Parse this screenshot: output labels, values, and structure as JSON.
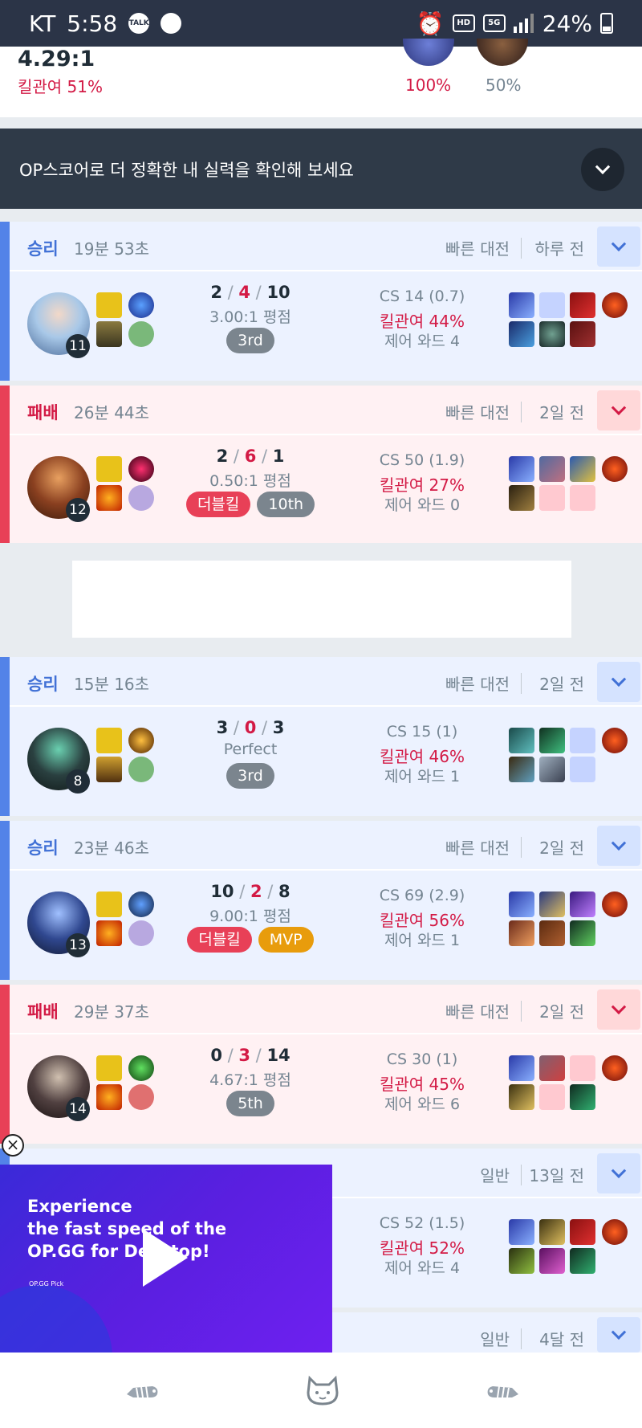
{
  "status": {
    "carrier": "KT",
    "time": "5:58",
    "battery": "24%",
    "icons": [
      "talk-icon",
      "cloud-icon",
      "alarm-icon",
      "hd-icon",
      "5g-icon",
      "signal-icon",
      "battery-icon"
    ]
  },
  "summary": {
    "kda_ratio": "4.29:1",
    "kill_participation": "킬관여 51%",
    "champions": [
      {
        "pct": "100%",
        "color": "#d31a45"
      },
      {
        "pct": "50%",
        "color": "#758592"
      }
    ]
  },
  "banner": {
    "text": "OP스코어로 더 정확한 내 실력을 확인해 보세요"
  },
  "matches": [
    {
      "result": "승리",
      "duration": "19분 53초",
      "queue": "빠른 대전",
      "ago": "하루 전",
      "level": "11",
      "k": "2",
      "d": "4",
      "a": "10",
      "ratio": "3.00:1 평점",
      "badges": [
        "3rd"
      ],
      "cs": "CS 14 (0.7)",
      "kp": "킬관여 44%",
      "ward": "제어 와드 4"
    },
    {
      "result": "패배",
      "duration": "26분 44초",
      "queue": "빠른 대전",
      "ago": "2일 전",
      "level": "12",
      "k": "2",
      "d": "6",
      "a": "1",
      "ratio": "0.50:1 평점",
      "badges": [
        "더블킬",
        "10th"
      ],
      "cs": "CS 50 (1.9)",
      "kp": "킬관여 27%",
      "ward": "제어 와드 0"
    },
    {
      "result": "승리",
      "duration": "15분 16초",
      "queue": "빠른 대전",
      "ago": "2일 전",
      "level": "8",
      "k": "3",
      "d": "0",
      "a": "3",
      "ratio": "Perfect",
      "badges": [
        "3rd"
      ],
      "cs": "CS 15 (1)",
      "kp": "킬관여 46%",
      "ward": "제어 와드 1"
    },
    {
      "result": "승리",
      "duration": "23분 46초",
      "queue": "빠른 대전",
      "ago": "2일 전",
      "level": "13",
      "k": "10",
      "d": "2",
      "a": "8",
      "ratio": "9.00:1 평점",
      "badges": [
        "더블킬",
        "MVP"
      ],
      "cs": "CS 69 (2.9)",
      "kp": "킬관여 56%",
      "ward": "제어 와드 1"
    },
    {
      "result": "패배",
      "duration": "29분 37초",
      "queue": "빠른 대전",
      "ago": "2일 전",
      "level": "14",
      "k": "0",
      "d": "3",
      "a": "14",
      "ratio": "4.67:1 평점",
      "badges": [
        "5th"
      ],
      "cs": "CS 30 (1)",
      "kp": "킬관여 45%",
      "ward": "제어 와드 6"
    },
    {
      "result": "",
      "duration": "",
      "queue": "일반",
      "ago": "13일 전",
      "level": "",
      "k": "",
      "d": "",
      "a": "",
      "ratio": "",
      "badges": [],
      "cs": "CS 52 (1.5)",
      "kp": "킬관여 52%",
      "ward": "제어 와드 4"
    },
    {
      "result": "",
      "duration": "",
      "queue": "일반",
      "ago": "4달 전"
    }
  ],
  "video_ad": {
    "text": "Experience\nthe fast speed of the\nOP.GG for Desktop!",
    "tag": "OP.GG Pick"
  },
  "colors": {
    "win_bar": "#5383e8",
    "lose_bar": "#e84057",
    "win_bg": "#ecf2ff",
    "lose_bg": "#fff1f3",
    "header_dark": "#2b3447"
  }
}
